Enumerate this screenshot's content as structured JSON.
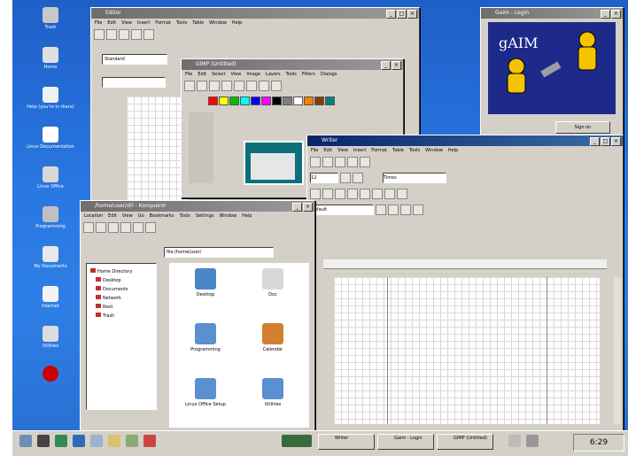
{
  "desktop": {
    "icons": [
      {
        "label": "Trash",
        "icon": "trash-icon",
        "color": "#c8c8c8"
      },
      {
        "label": "Home",
        "icon": "home-icon",
        "color": "#e0e0e0"
      },
      {
        "label": "Help (you're in there)",
        "icon": "help-icon",
        "color": "#f0f0f0"
      },
      {
        "label": "Linux Documentation",
        "icon": "document-icon",
        "color": "#ffffff"
      },
      {
        "label": "Linux Office",
        "icon": "office-icon",
        "color": "#d8d8d8"
      },
      {
        "label": "Programming",
        "icon": "programming-icon",
        "color": "#c0c0c0"
      },
      {
        "label": "My Documents",
        "icon": "folder-icon",
        "color": "#e8e8e8"
      },
      {
        "label": "Internet",
        "icon": "internet-icon",
        "color": "#f4f4f4"
      },
      {
        "label": "Utilities",
        "icon": "utilities-icon",
        "color": "#dcdcdc"
      },
      {
        "label": "",
        "icon": "redhat-icon",
        "color": "#cc0000"
      }
    ]
  },
  "windows": {
    "editor": {
      "title": "Editor",
      "menu": [
        "File",
        "Edit",
        "View",
        "Insert",
        "Format",
        "Tools",
        "Table",
        "Window",
        "Help"
      ],
      "field_value": "Standard"
    },
    "gimp": {
      "title": "GIMP (Untitled)",
      "menu": [
        "File",
        "Edit",
        "Select",
        "View",
        "Image",
        "Layers",
        "Tools",
        "Filters",
        "Dialogs"
      ],
      "palette": [
        "#ff0000",
        "#ffff00",
        "#00c000",
        "#00ffff",
        "#0000ff",
        "#ff00ff",
        "#000000",
        "#808080",
        "#ffffff",
        "#ff8000",
        "#804000",
        "#008080"
      ]
    },
    "gaim": {
      "title": "Gaim - Login",
      "logo_text": "gAIM",
      "button": "Sign on"
    },
    "writer": {
      "title": "Writer",
      "menu": [
        "File",
        "Edit",
        "View",
        "Insert",
        "Format",
        "Table",
        "Tools",
        "Window",
        "Help"
      ],
      "font_size": "12",
      "font_name": "Times",
      "style": "Default"
    },
    "files": {
      "title": "/home/user/d0 - Konqueror",
      "menu": [
        "Location",
        "Edit",
        "View",
        "Go",
        "Bookmarks",
        "Tools",
        "Settings",
        "Window",
        "Help"
      ],
      "address": "file:/home/user/",
      "tree": [
        "Home Directory",
        "Desktop",
        "Documents",
        "Network",
        "Root",
        "Trash"
      ],
      "files": [
        "Desktop",
        "Doc",
        "Programming",
        "Calendar",
        "Linux Office Setup",
        "Utilities"
      ]
    }
  },
  "taskbar": {
    "tasks": [
      "Writer",
      "Gaim - Login",
      "GIMP (Untitled)"
    ],
    "clock": "6:29"
  }
}
